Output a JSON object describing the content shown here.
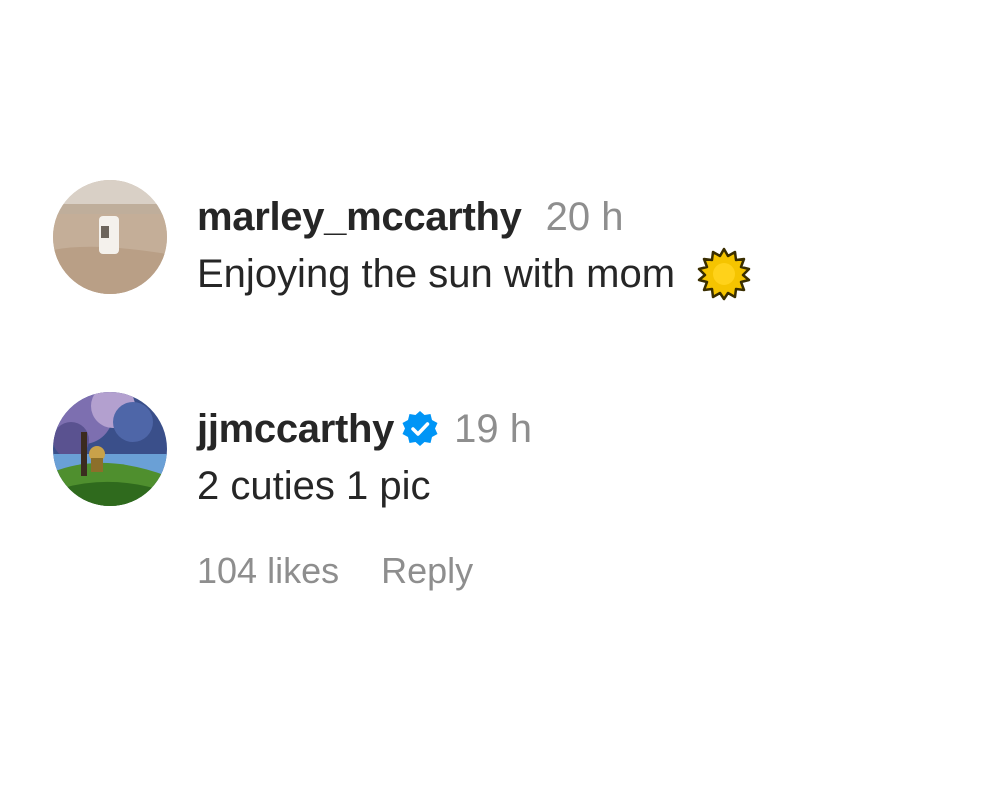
{
  "comments": [
    {
      "username": "marley_mccarthy",
      "timestamp": "20 h",
      "text": "Enjoying the sun with mom",
      "emoji": "sun-icon",
      "verified": false
    },
    {
      "username": "jjmccarthy",
      "timestamp": "19 h",
      "text": "2 cuties 1 pic",
      "verified": true,
      "likes": "104 likes",
      "reply_label": "Reply"
    }
  ],
  "colors": {
    "text_primary": "#262626",
    "text_secondary": "#8e8e8e",
    "verified_blue": "#0095f6",
    "sun_yellow": "#f5c400"
  }
}
